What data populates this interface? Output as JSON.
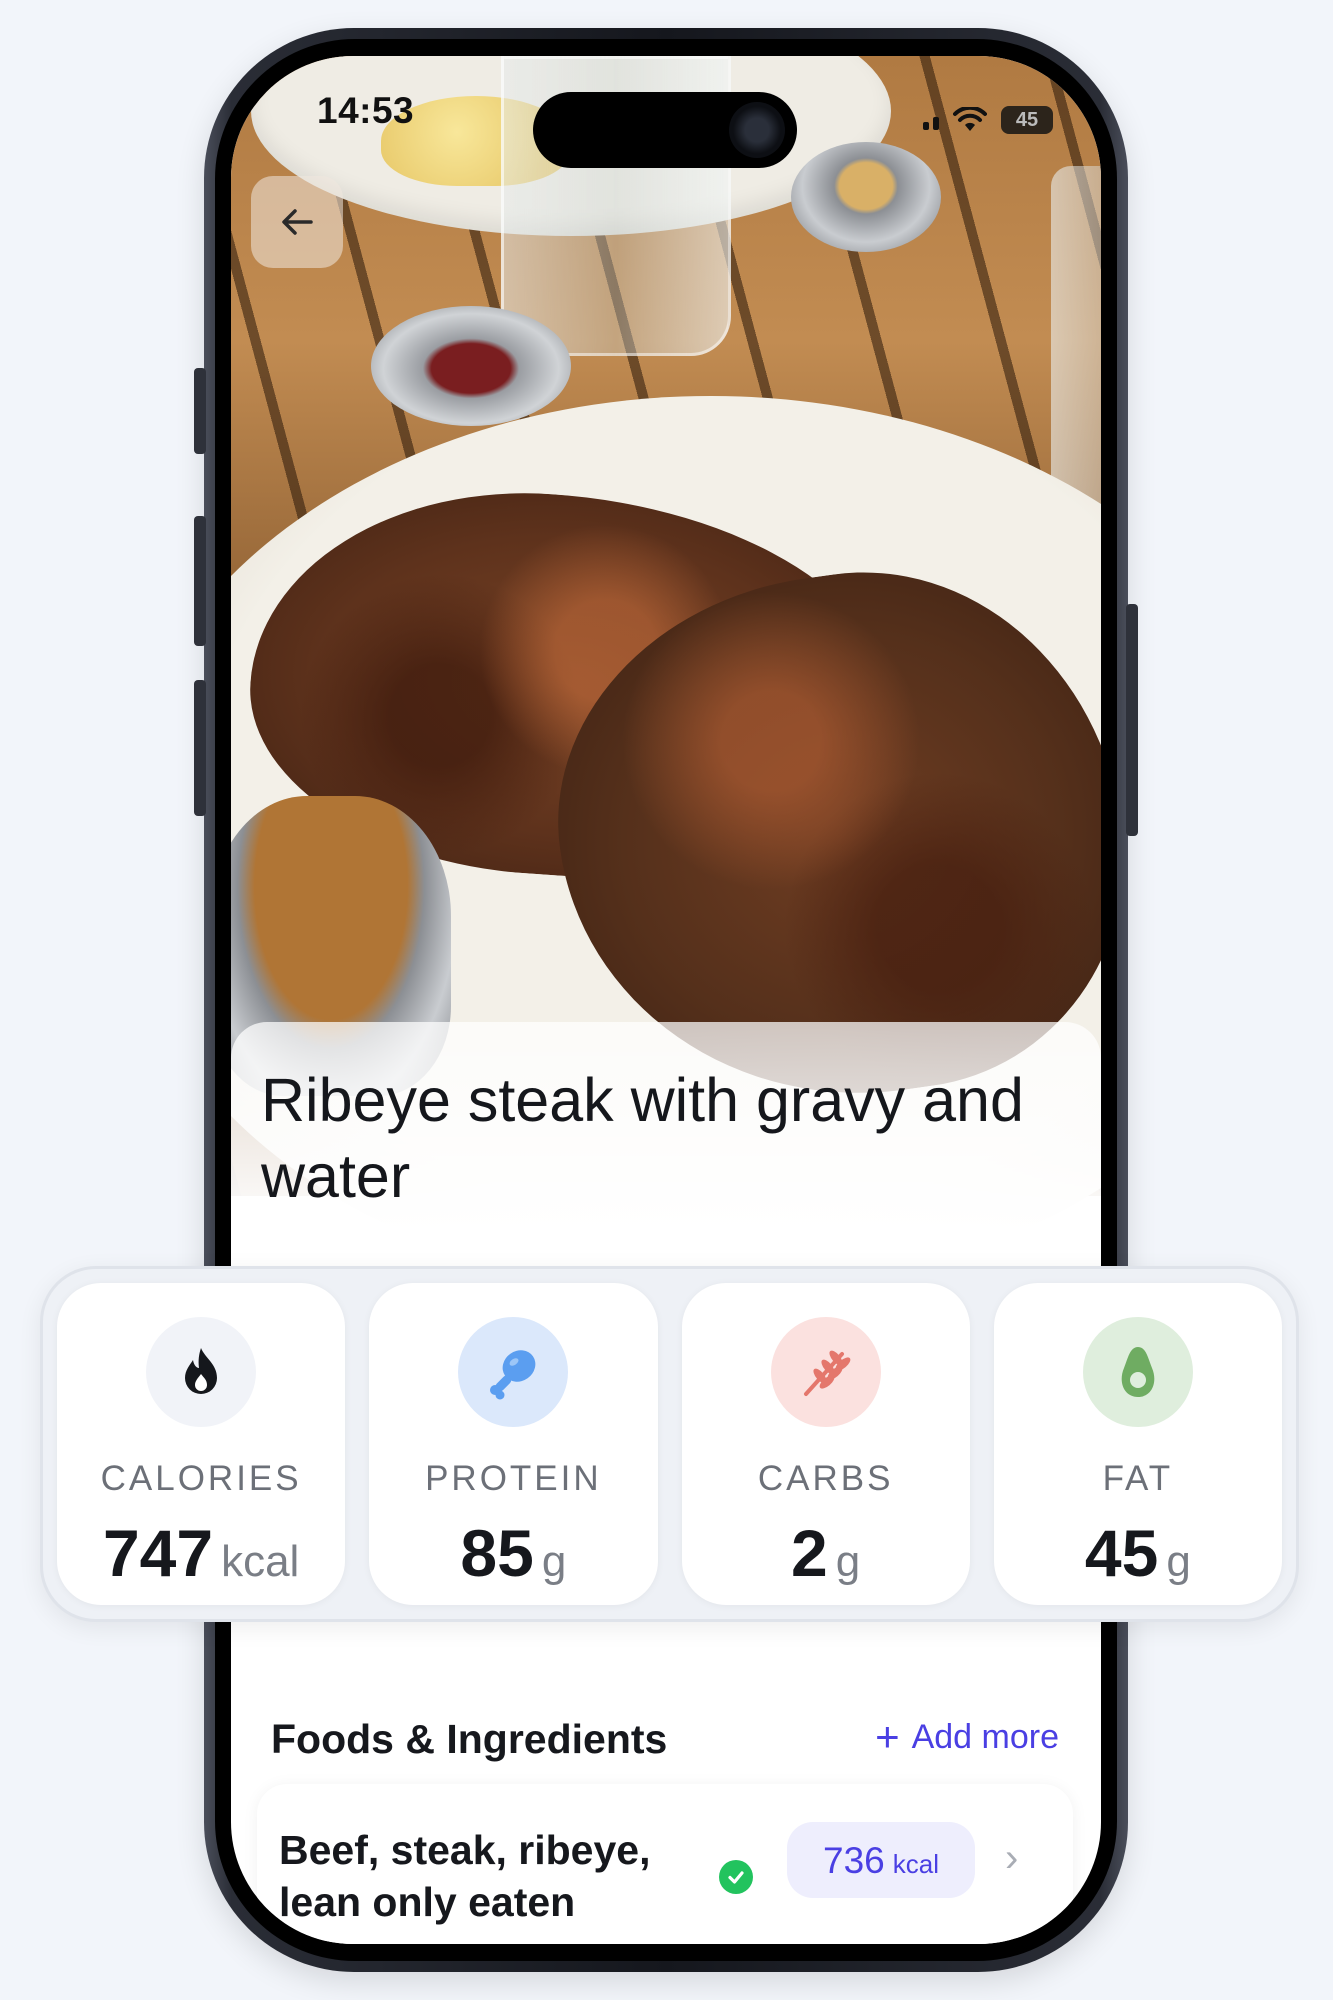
{
  "status_bar": {
    "time": "14:53",
    "battery": "45"
  },
  "icons": {
    "back": "arrow-left-icon",
    "calories": "flame-icon",
    "protein": "drumstick-icon",
    "carbs": "wheat-icon",
    "fat": "avocado-icon",
    "add": "plus-icon",
    "verified": "check-circle-icon",
    "chevron": "chevron-right-icon"
  },
  "meal": {
    "title": "Ribeye steak with gravy and water"
  },
  "macros": [
    {
      "label": "CALORIES",
      "value": "747",
      "unit": "kcal",
      "icon_bg": "#f1f3f8",
      "icon_color": "#15171c"
    },
    {
      "label": "PROTEIN",
      "value": "85",
      "unit": "g",
      "icon_bg": "#dbe8fb",
      "icon_color": "#5b9ef0"
    },
    {
      "label": "CARBS",
      "value": "2",
      "unit": "g",
      "icon_bg": "#fbe1df",
      "icon_color": "#e4776c"
    },
    {
      "label": "FAT",
      "value": "45",
      "unit": "g",
      "icon_bg": "#dfeedd",
      "icon_color": "#6fac62"
    }
  ],
  "foods": {
    "header": "Foods & Ingredients",
    "add_more": "Add more",
    "items": [
      {
        "name": "Beef, steak, ribeye, lean only eaten",
        "kcal": "736",
        "kcal_unit": "kcal"
      }
    ]
  },
  "colors": {
    "accent": "#4a3fe3",
    "verified": "#22c35e",
    "background": "#f2f5fa"
  }
}
